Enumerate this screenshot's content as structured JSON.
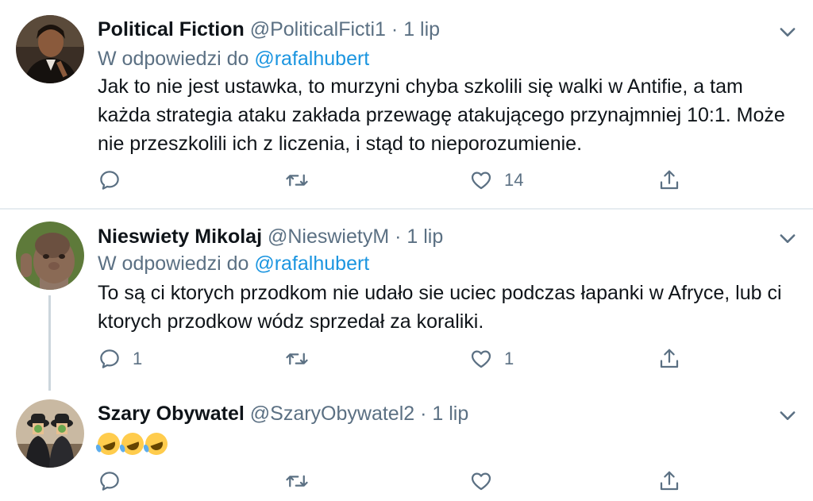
{
  "colors": {
    "accent": "#1b95e0",
    "secondary_text": "#5b7083",
    "divider": "#e6ecf0"
  },
  "tweets": [
    {
      "name": "Political Fiction",
      "handle": "@PoliticalFicti1",
      "separator": "·",
      "date": "1 lip",
      "reply_prefix": "W odpowiedzi do",
      "reply_mention": "@rafalhubert",
      "body": "Jak to nie jest ustawka, to murzyni chyba szkolili się walki w Antifie, a tam każda strategia ataku zakłada przewagę atakującego przynajmniej 10:1. Może nie przeszkolili ich z liczenia, i stąd to nieporozumienie.",
      "reply_count": "",
      "retweet_count": "",
      "like_count": "14"
    },
    {
      "name": "Nieswiety Mikolaj",
      "handle": "@NieswietyM",
      "separator": "·",
      "date": "1 lip",
      "reply_prefix": "W odpowiedzi do",
      "reply_mention": "@rafalhubert",
      "body": "To są ci ktorych przodkom nie udało sie uciec podczas łapanki w Afryce, lub ci ktorych przodkow wódz sprzedał za koraliki.",
      "reply_count": "1",
      "retweet_count": "",
      "like_count": "1"
    },
    {
      "name": "Szary Obywatel",
      "handle": "@SzaryObywatel2",
      "separator": "·",
      "date": "1 lip",
      "body_emoji": "rolling-on-floor-laughing-emoji ×3",
      "reply_count": "",
      "retweet_count": "",
      "like_count": ""
    }
  ],
  "icons": {
    "reply": "reply-icon",
    "retweet": "retweet-icon",
    "like": "heart-icon",
    "share": "share-icon",
    "more": "chevron-down-icon"
  }
}
